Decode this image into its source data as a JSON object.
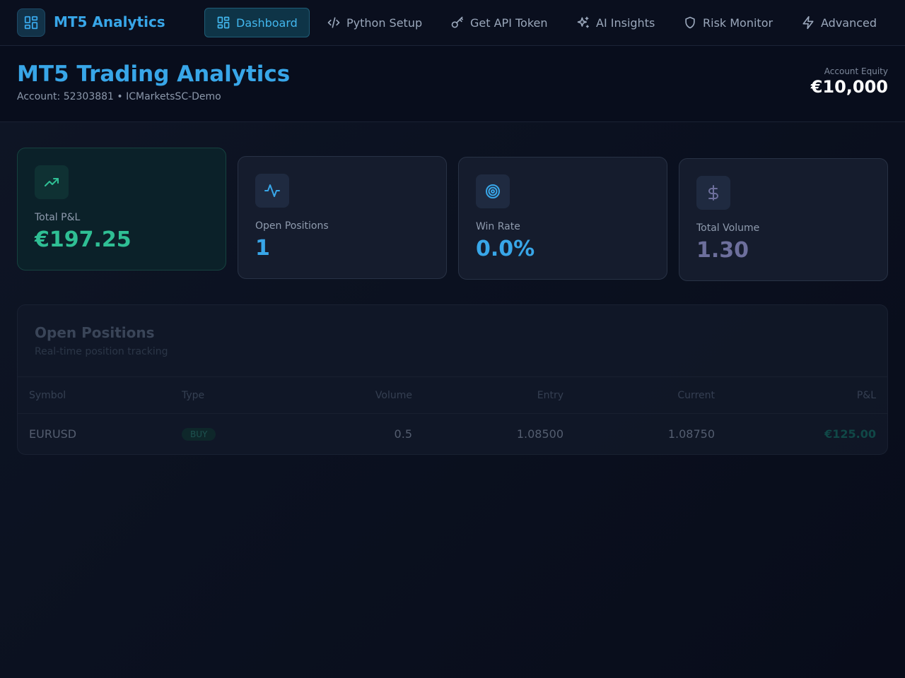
{
  "app": {
    "name": "MT5 Analytics"
  },
  "nav": {
    "items": [
      {
        "label": "Dashboard",
        "icon": "dashboard-grid-icon",
        "active": true
      },
      {
        "label": "Python Setup",
        "icon": "code-icon"
      },
      {
        "label": "Get API Token",
        "icon": "key-icon"
      },
      {
        "label": "AI Insights",
        "icon": "sparkles-icon"
      },
      {
        "label": "Risk Monitor",
        "icon": "shield-icon"
      },
      {
        "label": "Advanced",
        "icon": "lightning-icon"
      }
    ]
  },
  "header": {
    "title": "MT5 Trading Analytics",
    "account_line": "Account: 52303881 • ICMarketsSC-Demo",
    "equity_label": "Account Equity",
    "equity_value": "€10,000"
  },
  "stats": [
    {
      "label": "Total P&L",
      "value": "€197.25",
      "icon": "trending-up-icon",
      "color": "#2fbf94"
    },
    {
      "label": "Open Positions",
      "value": "1",
      "icon": "activity-icon",
      "color": "#38a6e8"
    },
    {
      "label": "Win Rate",
      "value": "0.0%",
      "icon": "target-icon",
      "color": "#38a6e8"
    },
    {
      "label": "Total Volume",
      "value": "1.30",
      "icon": "dollar-icon",
      "color": "#6d6f9c"
    }
  ],
  "positions": {
    "title": "Open Positions",
    "subtitle": "Real-time position tracking",
    "columns": [
      "Symbol",
      "Type",
      "Volume",
      "Entry",
      "Current",
      "P&L"
    ],
    "rows": [
      {
        "symbol": "EURUSD",
        "type": "BUY",
        "volume": "0.5",
        "entry": "1.08500",
        "current": "1.08750",
        "pnl": "€125.00"
      }
    ]
  }
}
